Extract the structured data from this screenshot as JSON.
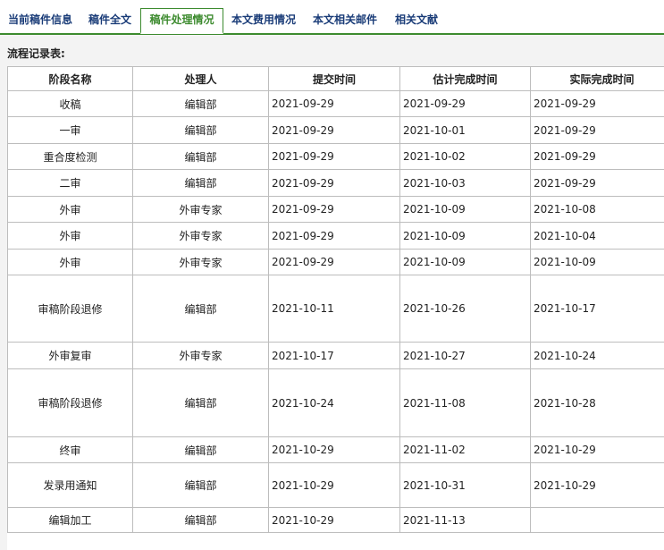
{
  "tabs": [
    {
      "label": "当前稿件信息"
    },
    {
      "label": "稿件全文"
    },
    {
      "label": "稿件处理情况"
    },
    {
      "label": "本文费用情况"
    },
    {
      "label": "本文相关邮件"
    },
    {
      "label": "相关文献"
    }
  ],
  "active_tab": "稿件处理情况",
  "colors": {
    "accent": "#3d8b2f",
    "tab_text": "#1a3c78",
    "panel_bg": "#f3f3f3"
  },
  "section_title": "流程记录表:",
  "table": {
    "headers": [
      "阶段名称",
      "处理人",
      "提交时间",
      "估计完成时间",
      "实际完成时间"
    ],
    "rows": [
      {
        "stage": "收稿",
        "handler": "编辑部",
        "submitted": "2021-09-29",
        "estimated": "2021-09-29",
        "actual": "2021-09-29"
      },
      {
        "stage": "一审",
        "handler": "编辑部",
        "submitted": "2021-09-29",
        "estimated": "2021-10-01",
        "actual": "2021-09-29"
      },
      {
        "stage": "重合度检测",
        "handler": "编辑部",
        "submitted": "2021-09-29",
        "estimated": "2021-10-02",
        "actual": "2021-09-29"
      },
      {
        "stage": "二审",
        "handler": "编辑部",
        "submitted": "2021-09-29",
        "estimated": "2021-10-03",
        "actual": "2021-09-29"
      },
      {
        "stage": "外审",
        "handler": "外审专家",
        "submitted": "2021-09-29",
        "estimated": "2021-10-09",
        "actual": "2021-10-08"
      },
      {
        "stage": "外审",
        "handler": "外审专家",
        "submitted": "2021-09-29",
        "estimated": "2021-10-09",
        "actual": "2021-10-04"
      },
      {
        "stage": "外审",
        "handler": "外审专家",
        "submitted": "2021-09-29",
        "estimated": "2021-10-09",
        "actual": "2021-10-09"
      },
      {
        "stage": "审稿阶段退修",
        "handler": "编辑部",
        "submitted": "2021-10-11",
        "estimated": "2021-10-26",
        "actual": "2021-10-17"
      },
      {
        "stage": "外审复审",
        "handler": "外审专家",
        "submitted": "2021-10-17",
        "estimated": "2021-10-27",
        "actual": "2021-10-24"
      },
      {
        "stage": "审稿阶段退修",
        "handler": "编辑部",
        "submitted": "2021-10-24",
        "estimated": "2021-11-08",
        "actual": "2021-10-28"
      },
      {
        "stage": "终审",
        "handler": "编辑部",
        "submitted": "2021-10-29",
        "estimated": "2021-11-02",
        "actual": "2021-10-29"
      },
      {
        "stage": "发录用通知",
        "handler": "编辑部",
        "submitted": "2021-10-29",
        "estimated": "2021-10-31",
        "actual": "2021-10-29"
      },
      {
        "stage": "编辑加工",
        "handler": "编辑部",
        "submitted": "2021-10-29",
        "estimated": "2021-11-13",
        "actual": ""
      }
    ]
  }
}
